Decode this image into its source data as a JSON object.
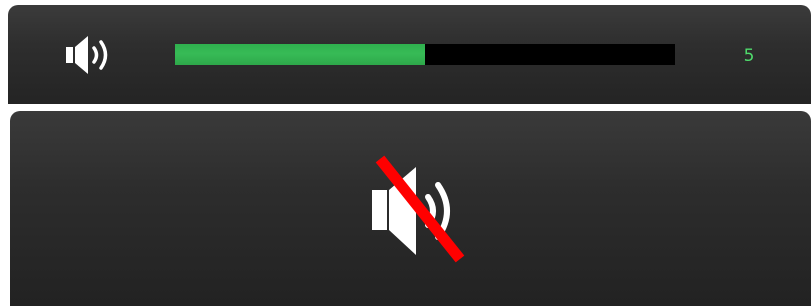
{
  "volume_osd": {
    "icon": "speaker-volume-icon",
    "level": 5,
    "level_text": "5",
    "level_fraction": 0.5,
    "fill_color": "#33b553",
    "text_color": "#4fdb6c"
  },
  "mute_osd": {
    "icon": "speaker-muted-icon",
    "slash_color": "#ff0000"
  }
}
